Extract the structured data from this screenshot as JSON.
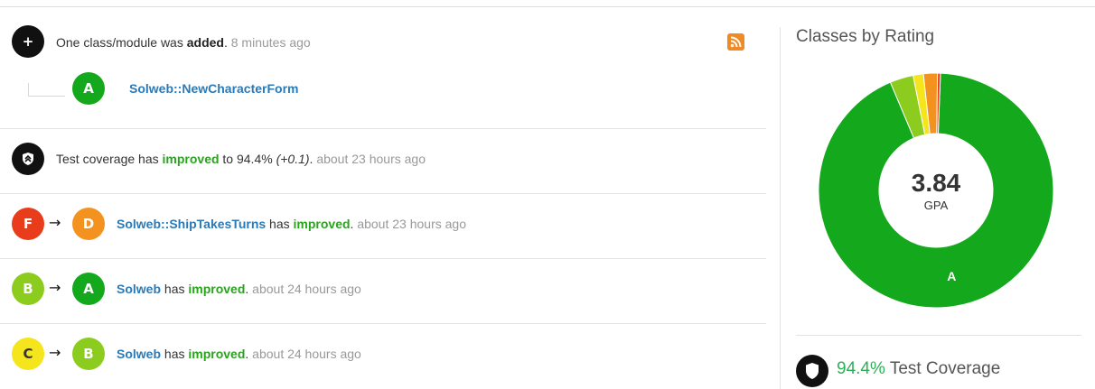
{
  "feed": {
    "events": [
      {
        "type": "added",
        "text_before": "One class/module was ",
        "text_bold": "added",
        "text_after": ".",
        "time": "8 minutes ago",
        "child": {
          "grade": "A",
          "name": "Solweb::NewCharacterForm"
        }
      },
      {
        "type": "coverage",
        "text_before": "Test coverage has ",
        "status": "improved",
        "text_mid": " to 94.4% ",
        "delta": "(+0.1)",
        "text_after": ".",
        "time": "about 23 hours ago"
      },
      {
        "type": "grade-change",
        "from": "F",
        "to": "D",
        "name": "Solweb::ShipTakesTurns",
        "has": " has ",
        "status": "improved",
        "dot": ".",
        "time": "about 23 hours ago"
      },
      {
        "type": "grade-change",
        "from": "B",
        "to": "A",
        "name": "Solweb",
        "has": " has ",
        "status": "improved",
        "dot": ".",
        "time": "about 24 hours ago"
      },
      {
        "type": "grade-change",
        "from": "C",
        "to": "B",
        "name": "Solweb",
        "has": " has ",
        "status": "improved",
        "dot": ".",
        "time": "about 24 hours ago"
      }
    ],
    "arrow": "→",
    "plus_glyph": "+",
    "rss_icon": "rss-icon"
  },
  "sidebar": {
    "title": "Classes by Rating",
    "gpa_value": "3.84",
    "gpa_label": "GPA",
    "coverage_value": "94.4%",
    "coverage_label": "Test Coverage"
  },
  "colors": {
    "A": "#14a81c",
    "B": "#8bcc1e",
    "C": "#f5e51c",
    "D": "#f3921f",
    "F": "#e83c1a",
    "link": "#2a7ab8",
    "improved": "#2aa31f",
    "coverage": "#2fae5a"
  },
  "chart_data": {
    "type": "pie",
    "title": "Classes by Rating",
    "center_value": "3.84",
    "center_label": "GPA",
    "categories": [
      "A",
      "B",
      "C",
      "D",
      "F"
    ],
    "values": [
      92.2,
      3.2,
      1.4,
      1.9,
      0.4
    ],
    "visible_labels": [
      "A"
    ]
  }
}
